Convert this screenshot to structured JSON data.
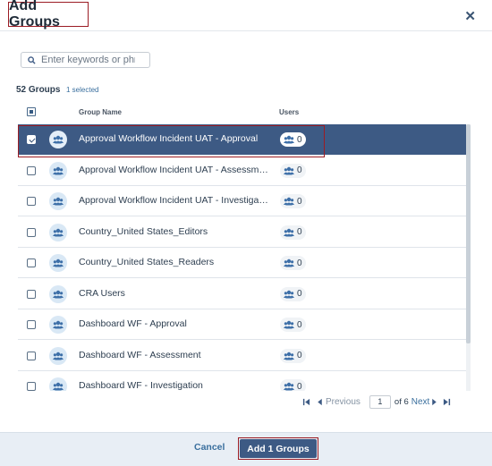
{
  "dialog": {
    "title": "Add Groups"
  },
  "search": {
    "placeholder": "Enter keywords or phra"
  },
  "summary": {
    "count_label": "52 Groups",
    "selected_label": "1 selected"
  },
  "table": {
    "headers": {
      "name": "Group Name",
      "users": "Users"
    },
    "rows": [
      {
        "name": "Approval Workflow Incident UAT - Approval",
        "users": "0",
        "selected": true
      },
      {
        "name": "Approval Workflow Incident UAT - Assessment",
        "users": "0",
        "selected": false
      },
      {
        "name": "Approval Workflow Incident UAT - Investigati...",
        "users": "0",
        "selected": false
      },
      {
        "name": "Country_United States_Editors",
        "users": "0",
        "selected": false
      },
      {
        "name": "Country_United States_Readers",
        "users": "0",
        "selected": false
      },
      {
        "name": "CRA Users",
        "users": "0",
        "selected": false
      },
      {
        "name": "Dashboard WF - Approval",
        "users": "0",
        "selected": false
      },
      {
        "name": "Dashboard WF - Assessment",
        "users": "0",
        "selected": false
      },
      {
        "name": "Dashboard WF - Investigation",
        "users": "0",
        "selected": false
      }
    ]
  },
  "pagination": {
    "previous_label": "Previous",
    "current_page": "1",
    "of_label": "of 6",
    "next_label": "Next"
  },
  "footer": {
    "cancel_label": "Cancel",
    "add_label": "Add 1 Groups"
  },
  "icons": {
    "close": "close-icon",
    "search": "search-icon",
    "group": "group-icon",
    "users": "users-icon",
    "first": "first-page-icon",
    "prev": "previous-page-icon",
    "next": "next-page-icon",
    "last": "last-page-icon"
  },
  "colors": {
    "accent": "#3d5a84",
    "highlight_outline": "#9b1c24",
    "link": "#3a6f9e"
  }
}
